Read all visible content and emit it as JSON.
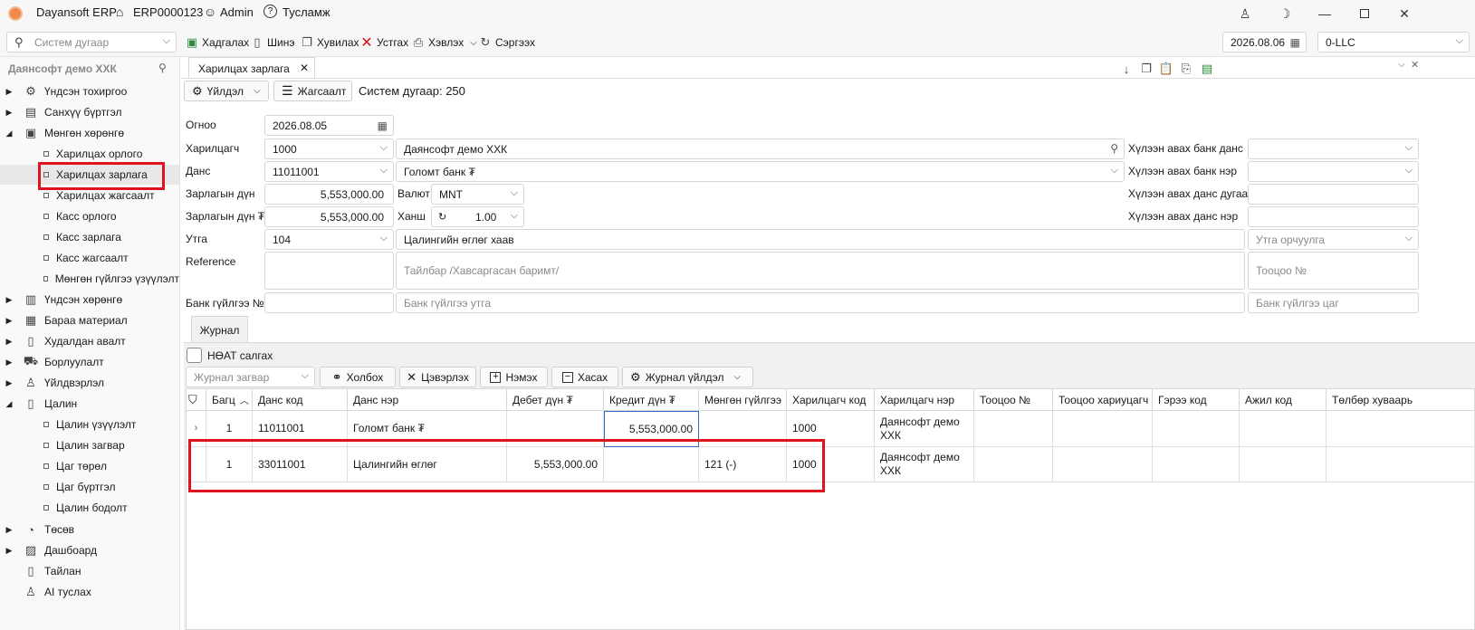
{
  "titlebar": {
    "app_name": "Dayansoft ERP",
    "company_code": "ERP0000123",
    "user": "Admin",
    "help": "Тусламж"
  },
  "toolbar": {
    "search_placeholder": "Систем дугаар",
    "save": "Хадгалах",
    "new": "Шинэ",
    "copy": "Хувилах",
    "delete": "Устгах",
    "print": "Хэвлэх",
    "refresh": "Сэргээх",
    "date": "2026.08.06",
    "branch": "0-LLC"
  },
  "sidebar": {
    "title": "Даянсофт демо ХХК",
    "items": [
      {
        "label": "Үндсэн тохиргоо"
      },
      {
        "label": "Санхүү бүртгэл"
      },
      {
        "label": "Мөнгөн хөрөнгө"
      },
      {
        "label": "Харилцах орлого"
      },
      {
        "label": "Харилцах зарлага"
      },
      {
        "label": "Харилцах жагсаалт"
      },
      {
        "label": "Касс орлого"
      },
      {
        "label": "Касс зарлага"
      },
      {
        "label": "Касс жагсаалт"
      },
      {
        "label": "Мөнгөн гүйлгээ үзүүлэлт"
      },
      {
        "label": "Үндсэн хөрөнгө"
      },
      {
        "label": "Бараа материал"
      },
      {
        "label": "Худалдан авалт"
      },
      {
        "label": "Борлуулалт"
      },
      {
        "label": "Үйлдвэрлэл"
      },
      {
        "label": "Цалин"
      },
      {
        "label": "Цалин үзүүлэлт"
      },
      {
        "label": "Цалин загвар"
      },
      {
        "label": "Цаг төрөл"
      },
      {
        "label": "Цаг бүртгэл"
      },
      {
        "label": "Цалин бодолт"
      },
      {
        "label": "Төсөв"
      },
      {
        "label": "Дашбоард"
      },
      {
        "label": "Тайлан"
      },
      {
        "label": "AI туслах"
      }
    ]
  },
  "tab": {
    "label": "Харилцах зарлага"
  },
  "actions": {
    "operation": "Үйлдэл",
    "list": "Жагсаалт",
    "system_number": "Систем дугаар: 250"
  },
  "form": {
    "date_label": "Огноо",
    "date_value": "2026.08.05",
    "partner_label": "Харилцагч",
    "partner_code": "1000",
    "partner_name": "Даянсофт демо ХХК",
    "account_label": "Данс",
    "account_code": "11011001",
    "account_name": "Голомт банк ₮",
    "amount_label": "Зарлагын дүн",
    "amount_value": "5,553,000.00",
    "amount_mnt_label": "Зарлагын дүн ₮",
    "amount_mnt_value": "5,553,000.00",
    "currency_label": "Валют",
    "currency_value": "MNT",
    "rate_label": "Ханш",
    "rate_value": "1.00",
    "content_label": "Утга",
    "content_code": "104",
    "content_text": "Цалингийн өглөг хаав",
    "content_translation_placeholder": "Утга орчуулга",
    "reference_label": "Reference",
    "description_placeholder": "Тайлбар /Хавсаргасан баримт/",
    "doc_no_placeholder": "Тооцоо №",
    "bank_tx_label": "Банк гүйлгээ №",
    "bank_tx_content_placeholder": "Банк гүйлгээ утга",
    "bank_tx_time_placeholder": "Банк гүйлгээ цаг",
    "recv_bank_account_label": "Хүлээн авах банк данс",
    "recv_bank_name_label": "Хүлээн авах банк нэр",
    "recv_account_no_label": "Хүлээн авах данс дугаар",
    "recv_account_name_label": "Хүлээн авах данс нэр"
  },
  "journal": {
    "tab_label": "Журнал",
    "vat_label": "НӨАТ салгах",
    "template_placeholder": "Журнал загвар",
    "link": "Холбох",
    "clear": "Цэвэрлэх",
    "add": "Нэмэх",
    "remove": "Хасах",
    "journal_action": "Журнал үйлдэл",
    "columns": [
      "Багц",
      "Данс код",
      "Данс нэр",
      "Дебет дүн ₮",
      "Кредит дүн ₮",
      "Мөнгөн гүйлгээ",
      "Харилцагч код",
      "Харилцагч нэр",
      "Тооцоо №",
      "Тооцоо хариуцагч",
      "Гэрээ код",
      "Ажил код",
      "Төлбөр хуваарь"
    ],
    "rows": [
      {
        "batch": "1",
        "account_code": "11011001",
        "account_name": "Голомт банк ₮",
        "debit": "",
        "credit": "5,553,000.00",
        "cashflow": "",
        "partner_code": "1000",
        "partner_name": "Даянсофт демо ХХК"
      },
      {
        "batch": "1",
        "account_code": "33011001",
        "account_name": "Цалингийн өглөг",
        "debit": "5,553,000.00",
        "credit": "",
        "cashflow": "121 (-)",
        "partner_code": "1000",
        "partner_name": "Даянсофт демо ХХК"
      }
    ]
  }
}
